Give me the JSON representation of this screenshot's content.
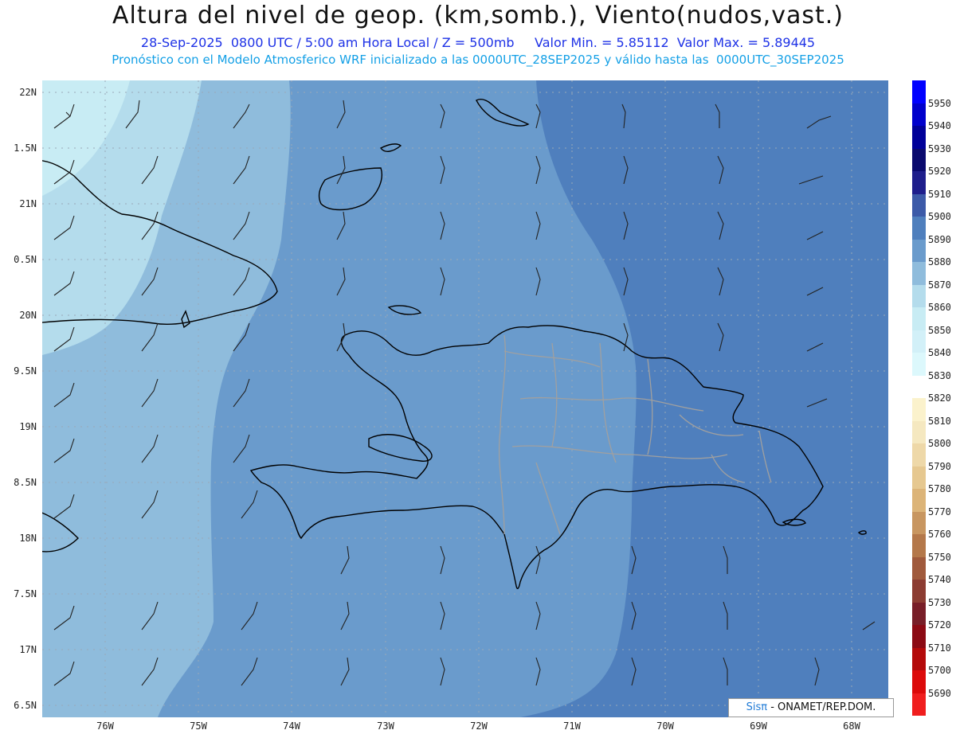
{
  "header": {
    "title": "Altura del nivel de geop. (km,somb.), Viento(nudos,vast.)",
    "subtitle_line1": "28-Sep-2025  0800 UTC / 5:00 am Hora Local / Z = 500mb     Valor Min. = 5.85112  Valor Max. = 5.89445",
    "subtitle_line2": "Pronóstico con el Modelo Atmosferico WRF inicializado a las 0000UTC_28SEP2025 y válido hasta las  0000UTC_30SEP2025"
  },
  "axes": {
    "y_labels": [
      "22N",
      "1.5N",
      "21N",
      "0.5N",
      "20N",
      "9.5N",
      "19N",
      "8.5N",
      "18N",
      "7.5N",
      "17N",
      "6.5N"
    ],
    "x_labels": [
      "76W",
      "75W",
      "74W",
      "73W",
      "72W",
      "71W",
      "70W",
      "69W",
      "68W"
    ]
  },
  "colorbar": {
    "labels": [
      "5950",
      "5940",
      "5930",
      "5920",
      "5910",
      "5900",
      "5890",
      "5880",
      "5870",
      "5860",
      "5850",
      "5840",
      "5830",
      "5820",
      "5810",
      "5800",
      "5790",
      "5780",
      "5770",
      "5760",
      "5750",
      "5740",
      "5730",
      "5720",
      "5710",
      "5700",
      "5690"
    ],
    "colors": [
      "#0000ff",
      "#0000cc",
      "#000099",
      "#0a0a6e",
      "#1e1e8c",
      "#3c5aa8",
      "#4f7fbd",
      "#6a9bcc",
      "#8fbcdc",
      "#b4dcec",
      "#c8ecf4",
      "#d2f0f8",
      "#dcf8fc",
      "#ffffff",
      "#fbf2cc",
      "#f5e8c0",
      "#eed8a8",
      "#e6c890",
      "#dcb478",
      "#c89660",
      "#b4784a",
      "#a05a3c",
      "#8c3c32",
      "#781e28",
      "#8c0a14",
      "#b40a0a",
      "#dc0a0a",
      "#f01e1e"
    ]
  },
  "credit": {
    "brand": "Sisπ",
    "text": " - ONAMET/REP.DOM."
  }
}
